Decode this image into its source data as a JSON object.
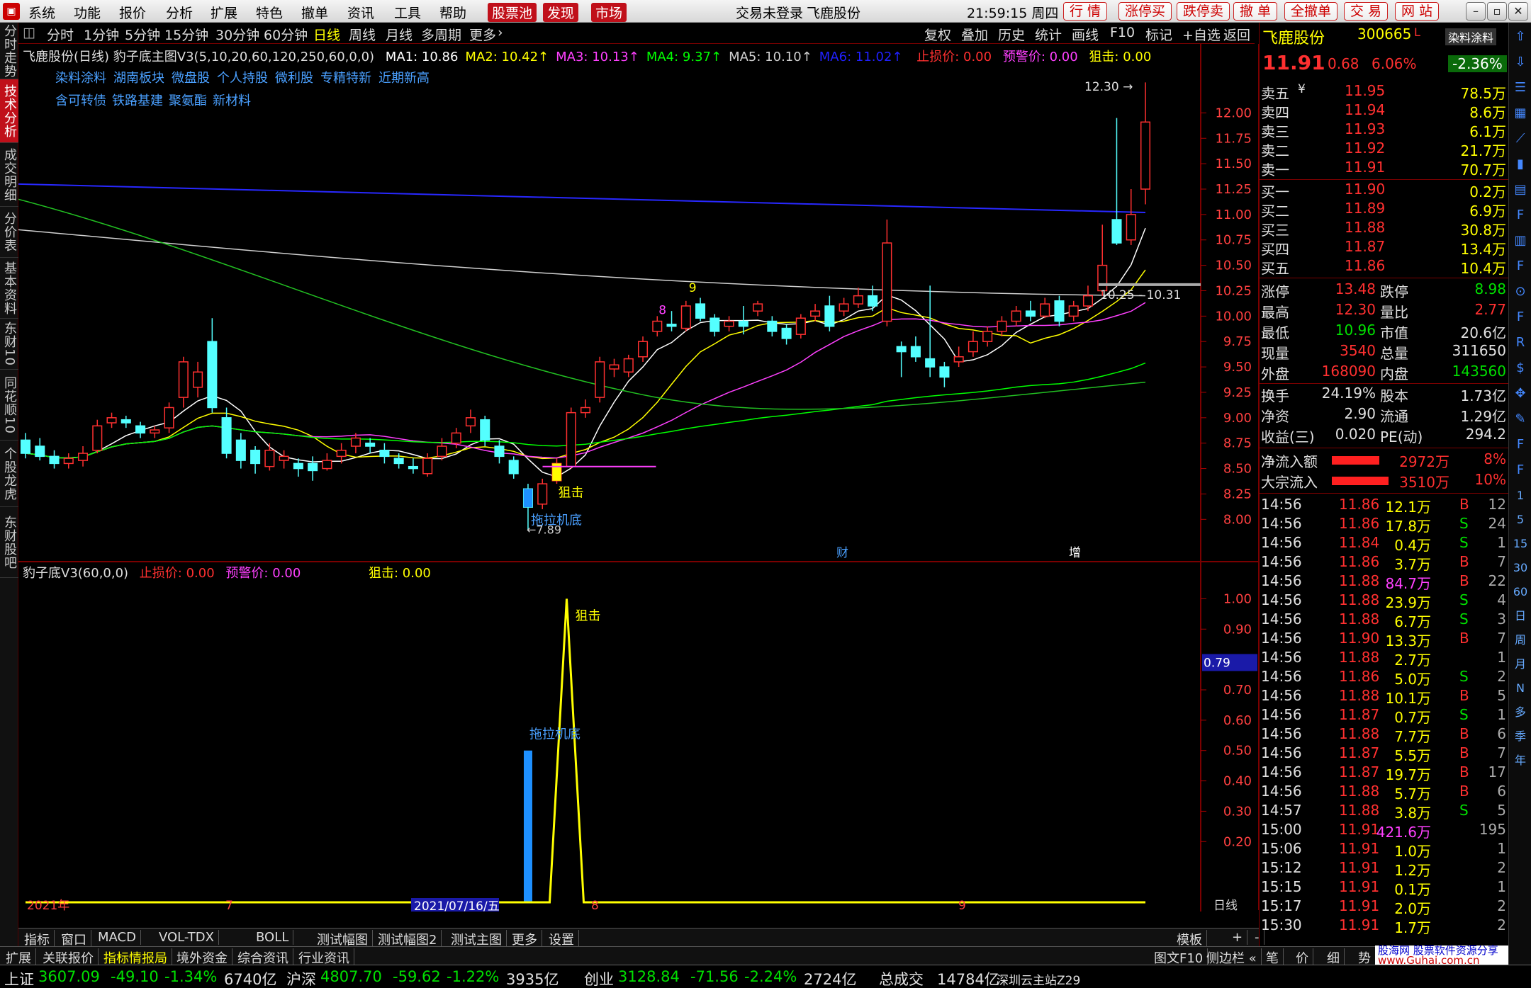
{
  "menubar": {
    "items": [
      "系统",
      "功能",
      "报价",
      "分析",
      "扩展",
      "特色",
      "撤单",
      "资讯",
      "工具",
      "帮助"
    ],
    "highlight": [
      "股票池",
      "发现",
      "市场"
    ],
    "login_status": "交易未登录",
    "stock_name": "飞鹿股份",
    "clock": "21:59:15 周四",
    "right_buttons": [
      "行 情",
      "涨停买",
      "跌停卖",
      "撤 单",
      "全撤单",
      "交 易",
      "网 站"
    ]
  },
  "left_tabs": [
    "分时走势",
    "技术分析",
    "成交明细",
    "分价表",
    "基本资料",
    "东财10",
    "同花顺10",
    "个股龙虎",
    "东财股吧"
  ],
  "left_tab_active": 1,
  "toolbar": {
    "periods": [
      "分时",
      "1分钟",
      "5分钟",
      "15分钟",
      "30分钟",
      "60分钟",
      "日线",
      "周线",
      "月线",
      "多周期",
      "更多"
    ],
    "active": "日线",
    "right": [
      "复权",
      "叠加",
      "历史",
      "统计",
      "画线",
      "F10",
      "标记",
      "+自选",
      "返回"
    ]
  },
  "main_chart": {
    "title": "飞鹿股份(日线)",
    "indicator": "豹子底主图V3(5,10,20,60,120,250,60,0,0)",
    "ma": [
      {
        "label": "MA1: 10.86",
        "color": "#ffffff"
      },
      {
        "label": "MA2: 10.42",
        "color": "#ffff00"
      },
      {
        "label": "MA3: 10.13",
        "color": "#ff40ff"
      },
      {
        "label": "MA4: 9.37",
        "color": "#00ff00"
      },
      {
        "label": "MA5: 10.10",
        "color": "#d0d0d0"
      },
      {
        "label": "MA6: 11.02",
        "color": "#2020ff"
      }
    ],
    "stop_loss": "止损价: 0.00",
    "warning": "预警价: 0.00",
    "snipe": "狙击: 0.00",
    "tags_line1": [
      "染料涂料",
      "湖南板块",
      "微盘股",
      "个人持股",
      "微利股",
      "专精特新",
      "近期新高"
    ],
    "tags_line2": [
      "含可转债",
      "铁路基建",
      "聚氨酯",
      "新材料"
    ],
    "label_high": "12.30",
    "label_low": "7.89",
    "label_range": "10.25 - 10.31",
    "label_snipe": "狙击",
    "label_pull": "拖拉机底",
    "label_cai": "财",
    "label_zeng": "增",
    "label_8": "8",
    "label_9": "9"
  },
  "chart_data": {
    "type": "candlestick",
    "ylim": [
      7.8,
      12.4
    ],
    "yticks": [
      8.0,
      8.25,
      8.5,
      8.75,
      9.0,
      9.25,
      9.5,
      9.75,
      10.0,
      10.25,
      10.5,
      10.75,
      11.0,
      11.25,
      11.5,
      11.75,
      12.0
    ],
    "candles": [
      [
        8.78,
        8.65,
        8.85,
        8.6
      ],
      [
        8.72,
        8.62,
        8.8,
        8.58
      ],
      [
        8.62,
        8.55,
        8.68,
        8.5
      ],
      [
        8.55,
        8.6,
        8.65,
        8.5
      ],
      [
        8.58,
        8.65,
        8.72,
        8.52
      ],
      [
        8.68,
        8.92,
        8.98,
        8.65
      ],
      [
        8.95,
        9.0,
        9.05,
        8.9
      ],
      [
        8.98,
        8.95,
        9.02,
        8.9
      ],
      [
        8.92,
        8.85,
        8.96,
        8.8
      ],
      [
        8.85,
        8.88,
        8.92,
        8.8
      ],
      [
        8.9,
        9.1,
        9.15,
        8.85
      ],
      [
        9.2,
        9.55,
        9.6,
        9.1
      ],
      [
        9.3,
        9.45,
        9.55,
        9.2
      ],
      [
        9.75,
        9.1,
        9.98,
        9.05
      ],
      [
        9.0,
        8.65,
        9.1,
        8.6
      ],
      [
        8.78,
        8.58,
        8.85,
        8.5
      ],
      [
        8.68,
        8.55,
        8.72,
        8.45
      ],
      [
        8.52,
        8.68,
        8.75,
        8.48
      ],
      [
        8.58,
        8.62,
        8.68,
        8.5
      ],
      [
        8.55,
        8.5,
        8.6,
        8.42
      ],
      [
        8.55,
        8.48,
        8.62,
        8.38
      ],
      [
        8.5,
        8.58,
        8.65,
        8.48
      ],
      [
        8.62,
        8.68,
        8.75,
        8.55
      ],
      [
        8.72,
        8.8,
        8.85,
        8.65
      ],
      [
        8.75,
        8.72,
        8.8,
        8.65
      ],
      [
        8.68,
        8.62,
        8.75,
        8.55
      ],
      [
        8.6,
        8.55,
        8.65,
        8.5
      ],
      [
        8.52,
        8.5,
        8.6,
        8.45
      ],
      [
        8.45,
        8.6,
        8.65,
        8.42
      ],
      [
        8.62,
        8.72,
        8.8,
        8.58
      ],
      [
        8.75,
        8.85,
        8.9,
        8.7
      ],
      [
        8.92,
        9.0,
        9.08,
        8.85
      ],
      [
        8.98,
        8.78,
        9.02,
        8.72
      ],
      [
        8.72,
        8.62,
        8.78,
        8.55
      ],
      [
        8.58,
        8.45,
        8.62,
        8.4
      ],
      [
        8.3,
        8.12,
        8.35,
        7.89
      ],
      [
        8.15,
        8.35,
        8.4,
        8.1
      ],
      [
        8.38,
        8.55,
        8.6,
        8.35
      ],
      [
        8.52,
        9.05,
        9.1,
        8.5
      ],
      [
        9.05,
        9.1,
        9.18,
        9.0
      ],
      [
        9.2,
        9.55,
        9.6,
        9.15
      ],
      [
        9.48,
        9.52,
        9.58,
        9.4
      ],
      [
        9.45,
        9.58,
        9.62,
        9.4
      ],
      [
        9.6,
        9.75,
        9.8,
        9.55
      ],
      [
        9.85,
        9.95,
        10.0,
        9.8
      ],
      [
        9.92,
        9.9,
        10.05,
        9.85
      ],
      [
        9.88,
        10.1,
        10.15,
        9.85
      ],
      [
        10.12,
        9.98,
        10.18,
        9.95
      ],
      [
        9.98,
        9.85,
        10.02,
        9.8
      ],
      [
        9.9,
        9.95,
        10.0,
        9.85
      ],
      [
        9.95,
        9.9,
        10.1,
        9.82
      ],
      [
        10.05,
        10.12,
        10.15,
        10.0
      ],
      [
        9.95,
        9.85,
        10.0,
        9.8
      ],
      [
        9.88,
        9.78,
        9.92,
        9.72
      ],
      [
        9.82,
        9.98,
        10.02,
        9.78
      ],
      [
        10.0,
        10.05,
        10.12,
        9.95
      ],
      [
        10.1,
        9.9,
        10.2,
        9.85
      ],
      [
        10.05,
        10.12,
        10.18,
        10.0
      ],
      [
        10.12,
        10.2,
        10.28,
        10.08
      ],
      [
        10.2,
        10.1,
        10.3,
        10.05
      ],
      [
        9.95,
        10.72,
        10.95,
        9.9
      ],
      [
        9.7,
        9.65,
        9.75,
        9.4
      ],
      [
        9.7,
        9.6,
        9.8,
        9.55
      ],
      [
        9.58,
        9.5,
        10.3,
        9.4
      ],
      [
        9.5,
        9.4,
        9.55,
        9.3
      ],
      [
        9.55,
        9.6,
        9.7,
        9.5
      ],
      [
        9.65,
        9.75,
        9.85,
        9.6
      ],
      [
        9.75,
        9.85,
        9.9,
        9.7
      ],
      [
        9.85,
        9.95,
        10.0,
        9.8
      ],
      [
        9.95,
        10.05,
        10.1,
        9.9
      ],
      [
        10.05,
        10.0,
        10.15,
        9.95
      ],
      [
        10.0,
        10.12,
        10.18,
        9.98
      ],
      [
        10.15,
        9.95,
        10.2,
        9.9
      ],
      [
        10.0,
        10.1,
        10.15,
        9.95
      ],
      [
        10.1,
        10.2,
        10.3,
        10.05
      ],
      [
        10.25,
        10.5,
        10.9,
        10.2
      ],
      [
        10.95,
        10.72,
        11.95,
        10.7
      ],
      [
        10.75,
        11.0,
        11.25,
        10.7
      ],
      [
        11.25,
        11.91,
        12.3,
        11.1
      ]
    ]
  },
  "sub_chart": {
    "title": "豹子底V3(60,0,0)",
    "stop_loss": "止损价: 0.00",
    "warning": "预警价: 0.00",
    "snipe": "狙击: 0.00",
    "label_snipe": "狙击",
    "label_pull": "拖拉机底",
    "yticks": [
      "1.00",
      "0.90",
      "0.79",
      "0.70",
      "0.60",
      "0.50",
      "0.40",
      "0.30",
      "0.20"
    ],
    "current": "0.79",
    "blue_bar_value": 0.5,
    "peak_value": 1.0
  },
  "xaxis": {
    "start": "2021年",
    "month7": "7",
    "highlight_date": "2021/07/16/五",
    "month8": "8",
    "month9": "9",
    "period": "日线"
  },
  "quote": {
    "name": "飞鹿股份",
    "code": "300665",
    "flag": "L",
    "sector_btn": "染料涂料",
    "sector_pct": "-2.36%",
    "price": "11.91",
    "change": "0.68",
    "pct": "6.06%",
    "asks": [
      {
        "label": "卖五",
        "price": "11.95",
        "vol": "78.5万"
      },
      {
        "label": "卖四",
        "price": "11.94",
        "vol": "8.6万"
      },
      {
        "label": "卖三",
        "price": "11.93",
        "vol": "6.1万"
      },
      {
        "label": "卖二",
        "price": "11.92",
        "vol": "21.7万"
      },
      {
        "label": "卖一",
        "price": "11.91",
        "vol": "70.7万"
      }
    ],
    "bids": [
      {
        "label": "买一",
        "price": "11.90",
        "vol": "0.2万"
      },
      {
        "label": "买二",
        "price": "11.89",
        "vol": "6.9万"
      },
      {
        "label": "买三",
        "price": "11.88",
        "vol": "30.8万"
      },
      {
        "label": "买四",
        "price": "11.87",
        "vol": "13.4万"
      },
      {
        "label": "买五",
        "price": "11.86",
        "vol": "10.4万"
      }
    ],
    "yen": "¥",
    "stats": [
      {
        "l1": "涨停",
        "v1": "13.48",
        "c1": "red",
        "l2": "跌停",
        "v2": "8.98",
        "c2": "green"
      },
      {
        "l1": "最高",
        "v1": "12.30",
        "c1": "red",
        "l2": "量比",
        "v2": "2.77",
        "c2": "red"
      },
      {
        "l1": "最低",
        "v1": "10.96",
        "c1": "green",
        "l2": "市值",
        "v2": "20.6亿",
        "c2": "white"
      },
      {
        "l1": "现量",
        "v1": "3540",
        "c1": "red",
        "l2": "总量",
        "v2": "311650",
        "c2": "white"
      },
      {
        "l1": "外盘",
        "v1": "168090",
        "c1": "red",
        "l2": "内盘",
        "v2": "143560",
        "c2": "green"
      },
      {
        "l1": "换手",
        "v1": "24.19%",
        "c1": "white",
        "l2": "股本",
        "v2": "1.73亿",
        "c2": "white"
      },
      {
        "l1": "净资",
        "v1": "2.90",
        "c1": "white",
        "l2": "流通",
        "v2": "1.29亿",
        "c2": "white"
      },
      {
        "l1": "收益(三)",
        "v1": "0.020",
        "c1": "white",
        "l2": "PE(动)",
        "v2": "294.2",
        "c2": "white"
      }
    ],
    "flows": [
      {
        "label": "净流入额",
        "value": "2972万",
        "pct": "8%",
        "bar": 0.8
      },
      {
        "label": "大宗流入",
        "value": "3510万",
        "pct": "10%",
        "bar": 0.95
      }
    ],
    "ticks": [
      [
        "14:56",
        "11.86",
        "12.1万",
        "B",
        "12",
        "red"
      ],
      [
        "14:56",
        "11.86",
        "17.8万",
        "S",
        "24",
        "green"
      ],
      [
        "14:56",
        "11.84",
        "0.4万",
        "S",
        "1",
        "green"
      ],
      [
        "14:56",
        "11.86",
        "3.7万",
        "B",
        "7",
        "red"
      ],
      [
        "14:56",
        "11.88",
        "84.7万",
        "B",
        "22",
        "red"
      ],
      [
        "14:56",
        "11.88",
        "23.9万",
        "S",
        "4",
        "green"
      ],
      [
        "14:56",
        "11.88",
        "6.7万",
        "S",
        "3",
        "green"
      ],
      [
        "14:56",
        "11.90",
        "13.3万",
        "B",
        "7",
        "red"
      ],
      [
        "14:56",
        "11.88",
        "2.7万",
        "",
        "1",
        "white"
      ],
      [
        "14:56",
        "11.86",
        "5.0万",
        "S",
        "2",
        "green"
      ],
      [
        "14:56",
        "11.88",
        "10.1万",
        "B",
        "5",
        "red"
      ],
      [
        "14:56",
        "11.87",
        "0.7万",
        "S",
        "1",
        "green"
      ],
      [
        "14:56",
        "11.88",
        "7.7万",
        "B",
        "6",
        "red"
      ],
      [
        "14:56",
        "11.87",
        "5.5万",
        "B",
        "7",
        "red"
      ],
      [
        "14:56",
        "11.87",
        "19.7万",
        "B",
        "17",
        "red"
      ],
      [
        "14:56",
        "11.88",
        "5.7万",
        "B",
        "6",
        "red"
      ],
      [
        "14:57",
        "11.88",
        "3.8万",
        "S",
        "5",
        "green"
      ],
      [
        "15:00",
        "11.91",
        "421.6万",
        "",
        "195",
        "white"
      ],
      [
        "15:06",
        "11.91",
        "1.0万",
        "",
        "1",
        "white"
      ],
      [
        "15:12",
        "11.91",
        "1.2万",
        "",
        "2",
        "white"
      ],
      [
        "15:15",
        "11.91",
        "0.1万",
        "",
        "1",
        "white"
      ],
      [
        "15:17",
        "11.91",
        "2.0万",
        "",
        "2",
        "white"
      ],
      [
        "15:30",
        "11.91",
        "1.7万",
        "",
        "2",
        "white"
      ]
    ]
  },
  "bottom_tabs": [
    "指标",
    "窗口",
    "MACD",
    "VOL-TDX",
    "BOLL",
    "测试幅图",
    "测试幅图2",
    "测试主图",
    "更多",
    "设置"
  ],
  "bottom_tabs_right": [
    "模板",
    "+",
    "-"
  ],
  "bottom_tabs2": [
    "扩展",
    "关联报价",
    "指标情报局",
    "境外资金",
    "综合资讯",
    "行业资讯"
  ],
  "bottom_tabs2_right": [
    "图文F10",
    "侧边栏 «",
    "笔",
    "价",
    "细",
    "势"
  ],
  "watermark": [
    "股海网 股票软件资源分享",
    "www.Guhai.com.cn"
  ],
  "statusbar": {
    "items": [
      {
        "name": "上证",
        "value": "3607.09",
        "chg": "-49.10",
        "pct": "-1.34%",
        "amt": "6740亿"
      },
      {
        "name": "沪深",
        "value": "4807.70",
        "chg": "-59.62",
        "pct": "-1.22%",
        "amt": "3935亿"
      },
      {
        "name": "创业",
        "value": "3128.84",
        "chg": "-71.56",
        "pct": "-2.24%",
        "amt": "2724亿"
      }
    ],
    "total_label": "总成交",
    "total": "14784亿",
    "site": "深圳云主站Z29"
  },
  "right_icons": [
    "arrow-up-icon",
    "arrow-down-icon",
    "list-icon",
    "grid-icon",
    "chart-icon",
    "candle-icon",
    "table-icon",
    "f10-icon",
    "bar-icon",
    "f2-icon",
    "compass-icon",
    "f4-icon",
    "rsi-icon",
    "money-icon",
    "move-icon",
    "pen-icon",
    "f5-icon",
    "f6-icon",
    "1",
    "5",
    "15",
    "30",
    "60",
    "日",
    "周",
    "月",
    "N",
    "多",
    "季",
    "年"
  ]
}
